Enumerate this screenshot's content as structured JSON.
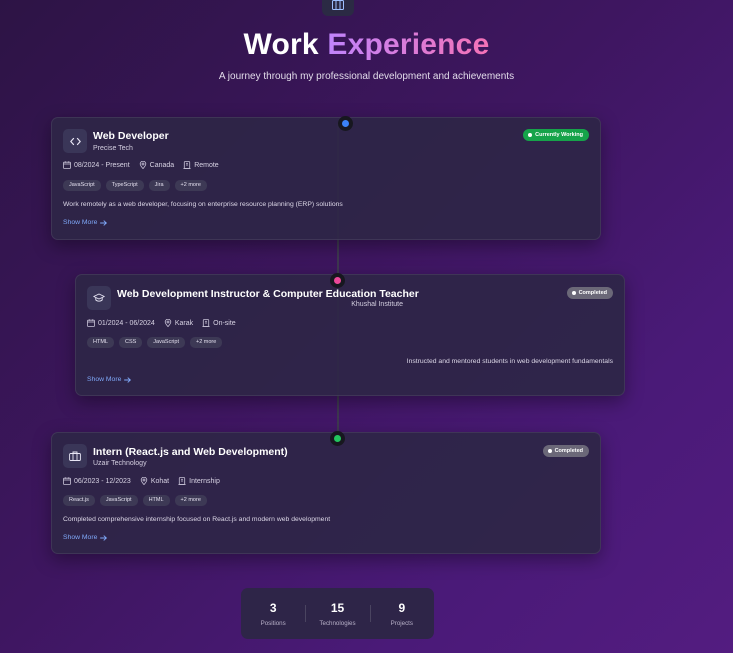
{
  "header": {
    "title_main": "Work",
    "title_accent": "Experience",
    "subtitle": "A journey through my professional development and achievements"
  },
  "experiences": [
    {
      "role": "Web Developer",
      "company": "Precise Tech",
      "status": "Currently Working",
      "dates": "08/2024 - Present",
      "location": "Canada",
      "mode": "Remote",
      "tags": [
        "JavaScript",
        "TypeScript",
        "Jira",
        "+2 more"
      ],
      "description": "Work remotely as a web developer, focusing on enterprise resource planning (ERP) solutions",
      "show_more": "Show More",
      "icon": "code-icon",
      "dot_color": "#3b82f6"
    },
    {
      "role": "Web Development Instructor & Computer Education Teacher",
      "company": "Khushal Institute",
      "status": "Completed",
      "dates": "01/2024 - 06/2024",
      "location": "Karak",
      "mode": "On-site",
      "tags": [
        "HTML",
        "CSS",
        "JavaScript",
        "+2 more"
      ],
      "description": "Instructed and mentored students in web development fundamentals",
      "show_more": "Show More",
      "icon": "graduation-cap-icon",
      "dot_color": "#ec4899"
    },
    {
      "role": "Intern (React.js and Web Development)",
      "company": "Uzair Technology",
      "status": "Completed",
      "dates": "06/2023 - 12/2023",
      "location": "Kohat",
      "mode": "Internship",
      "tags": [
        "React.js",
        "JavaScript",
        "HTML",
        "+2 more"
      ],
      "description": "Completed comprehensive internship focused on React.js and modern web development",
      "show_more": "Show More",
      "icon": "briefcase-icon",
      "dot_color": "#22c55e"
    }
  ],
  "stats": [
    {
      "value": "3",
      "label": "Positions"
    },
    {
      "value": "15",
      "label": "Technologies"
    },
    {
      "value": "9",
      "label": "Projects"
    }
  ],
  "colors": {
    "accent_gradient_start": "#c084fc",
    "accent_gradient_end": "#f472b6",
    "link": "#7fa8f8",
    "badge_current": "#16a34a",
    "badge_completed": "#6b6878"
  }
}
